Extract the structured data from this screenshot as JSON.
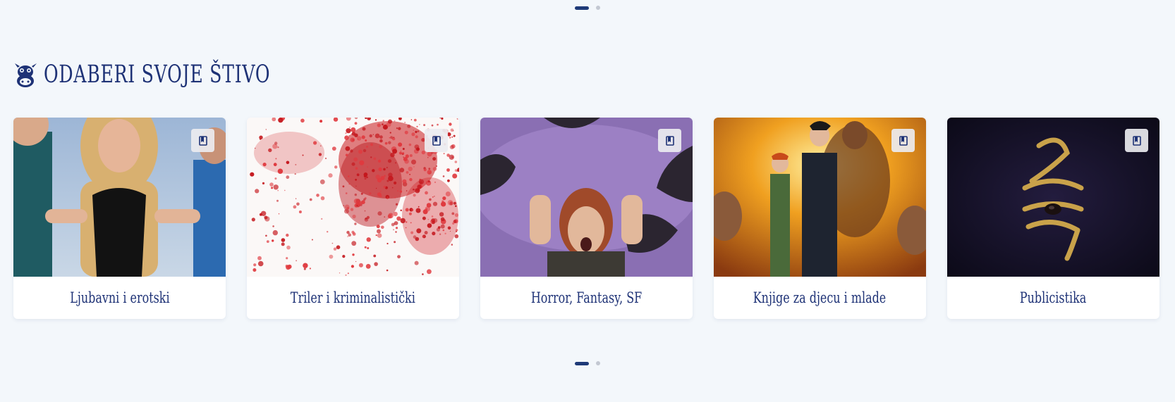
{
  "section": {
    "title": "ODABERI SVOJE ŠTIVO",
    "icon": "cow-icon"
  },
  "carousel": {
    "pages": 2,
    "active_page": 1
  },
  "colors": {
    "accent": "#1e3276",
    "background": "#f3f7fb"
  },
  "categories": [
    {
      "label": "Ljubavni i erotski",
      "icon": "book-icon"
    },
    {
      "label": "Triler i kriminalistički",
      "icon": "book-icon"
    },
    {
      "label": "Horror, Fantasy, SF",
      "icon": "book-icon"
    },
    {
      "label": "Knjige za djecu i mlade",
      "icon": "book-icon"
    },
    {
      "label": "Publicistika",
      "icon": "book-icon"
    }
  ]
}
